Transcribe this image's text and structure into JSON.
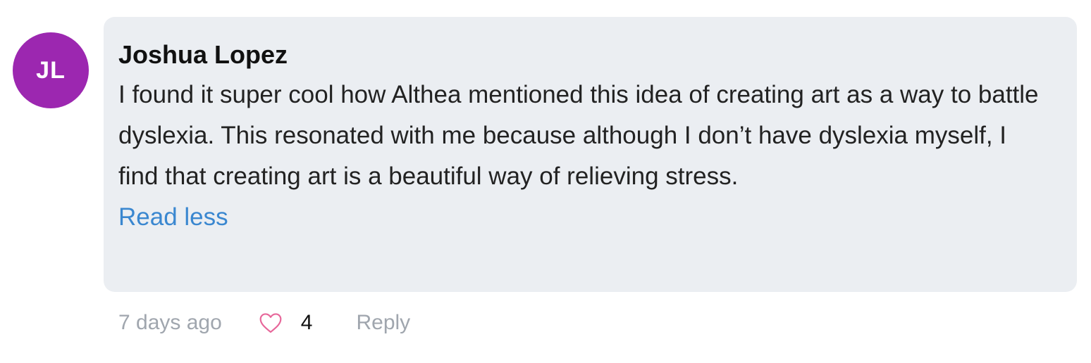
{
  "comment": {
    "avatar_initials": "JL",
    "avatar_color": "#9c27b0",
    "author": "Joshua Lopez",
    "text": "I found it super cool how Althea mentioned this idea of creating art as a way to battle dyslexia. This resonated with me because although I don’t have dyslexia myself, I find that creating art is a beautiful way of relieving stress.",
    "read_less_label": "Read less",
    "timestamp": "7 days ago",
    "like_icon": "heart-outline-icon",
    "like_color": "#e7679a",
    "like_count": "4",
    "reply_label": "Reply"
  }
}
